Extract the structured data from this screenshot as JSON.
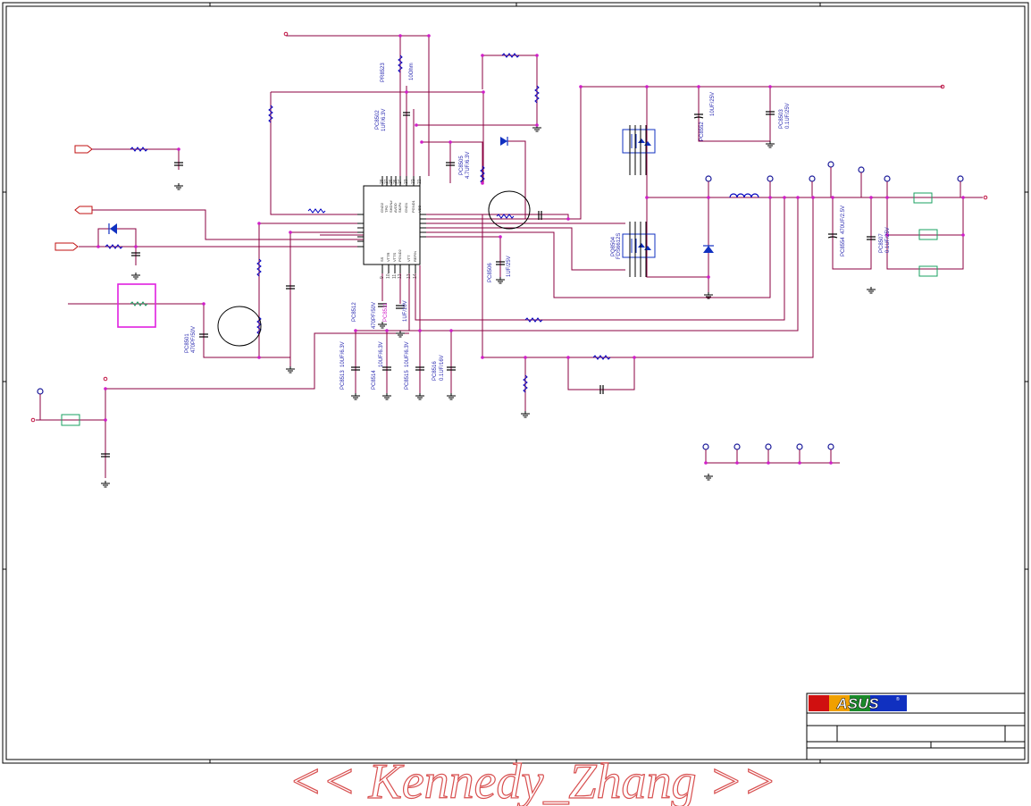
{
  "brand": {
    "logo_text": "ASUS",
    "logo_mark": "®"
  },
  "watermark": "<< Kennedy_Zhang >>",
  "ic": {
    "pins_top": [
      "GND2",
      "TPG",
      "SHDN#",
      "AVDD",
      "SKIP#",
      "GND1",
      "PGND1",
      "VDD"
    ],
    "pins_top_num": [
      "28",
      "27",
      "26",
      "25",
      "24",
      "23",
      "22",
      "21"
    ],
    "pins_bottom": [
      "SS",
      "VTTR",
      "VTTS",
      "PGND2",
      "VTT",
      "REFIN"
    ],
    "pins_bottom_num": [
      "9",
      "10",
      "11",
      "12",
      "13",
      "14"
    ]
  },
  "components": {
    "pr8523": "PR8523",
    "pr8523_val": "10Ohm",
    "pc8502": "PC8502",
    "pc8502_val": "1UF/6.3V",
    "pc8505": "PC8505",
    "pc8505_val": "4.7UF/6.3V",
    "pc8506": "PC8506",
    "pc8506_val": "1UF/25V",
    "pc8552": "PC8552",
    "pc8552_val": "10UF/25V",
    "pc8503": "PC8503",
    "pc8503_val": "0.1UF/25V",
    "pq8504": "PQ8504",
    "pq8504_val": "FDS6612S",
    "pc8554": "PC8554",
    "pc8554_val": "470UF/2.5V",
    "pc8507": "PC8507",
    "pc8507_val": "0.1UF/25V",
    "pc8501": "PC8501",
    "pc8501_val": "470PF/50V",
    "pc8512": "PC8512",
    "pc8512_val": "470PF/50V",
    "pc8511": "PC8511",
    "pc8511_val": "1UF/10V",
    "pc8513": "PC8513",
    "pc8513_val": "10UF/6.3V",
    "pc8514": "PC8514",
    "pc8514_val": "10UF/6.3V",
    "pc8515": "PC8515",
    "pc8515_val": "10UF/6.3V",
    "pc8516": "PC8516",
    "pc8516_val": "0.1UF/16V"
  },
  "colors": {
    "wire": "#8b0040",
    "junction": "#d01ec8",
    "resistor": "#0000c0",
    "highlight": "#e020e0",
    "ferrite": "#1aa060"
  }
}
